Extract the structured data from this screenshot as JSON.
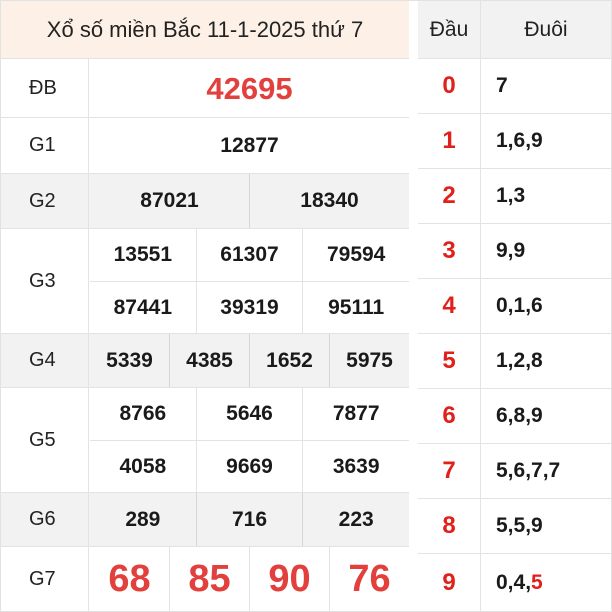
{
  "title": "Xổ số miền Bắc 11-1-2025 thứ 7",
  "prizes": {
    "db": {
      "label": "ĐB",
      "numbers": [
        "42695"
      ]
    },
    "g1": {
      "label": "G1",
      "numbers": [
        "12877"
      ]
    },
    "g2": {
      "label": "G2",
      "numbers": [
        "87021",
        "18340"
      ]
    },
    "g3": {
      "label": "G3",
      "numbers": [
        "13551",
        "61307",
        "79594",
        "87441",
        "39319",
        "95111"
      ]
    },
    "g4": {
      "label": "G4",
      "numbers": [
        "5339",
        "4385",
        "1652",
        "5975"
      ]
    },
    "g5": {
      "label": "G5",
      "numbers": [
        "8766",
        "5646",
        "7877",
        "4058",
        "9669",
        "3639"
      ]
    },
    "g6": {
      "label": "G6",
      "numbers": [
        "289",
        "716",
        "223"
      ]
    },
    "g7": {
      "label": "G7",
      "numbers": [
        "68",
        "85",
        "90",
        "76"
      ]
    }
  },
  "loto": {
    "head_label": "Đầu",
    "tail_label": "Đuôi",
    "rows": [
      {
        "head": "0",
        "tail": "7",
        "tail_hl": ""
      },
      {
        "head": "1",
        "tail": "1,6,9",
        "tail_hl": ""
      },
      {
        "head": "2",
        "tail": "1,3",
        "tail_hl": ""
      },
      {
        "head": "3",
        "tail": "9,9",
        "tail_hl": ""
      },
      {
        "head": "4",
        "tail": "0,1,6",
        "tail_hl": ""
      },
      {
        "head": "5",
        "tail": "1,2,8",
        "tail_hl": ""
      },
      {
        "head": "6",
        "tail": "6,8,9",
        "tail_hl": ""
      },
      {
        "head": "7",
        "tail": "5,6,7,7",
        "tail_hl": ""
      },
      {
        "head": "8",
        "tail": "5,5,9",
        "tail_hl": ""
      },
      {
        "head": "9",
        "tail": "0,4,",
        "tail_hl": "5"
      }
    ]
  },
  "colors": {
    "accent_red": "#e2403c",
    "header_bg": "#fdf1e7",
    "shade_bg": "#f2f2f2"
  }
}
